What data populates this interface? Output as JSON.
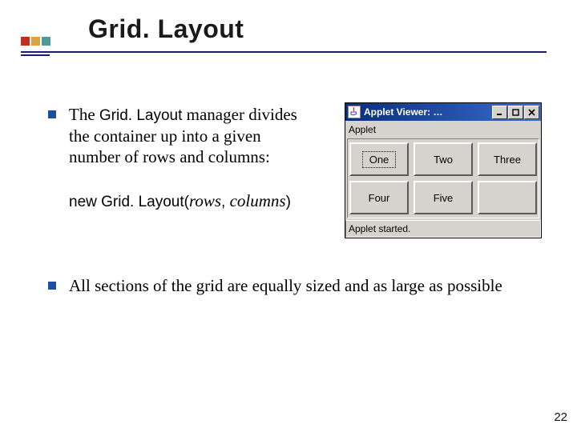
{
  "title": "Grid. Layout",
  "bullets": {
    "first": {
      "prefix": "The ",
      "class_name": "Grid. Layout",
      "rest": " manager divides the container up into a given number of rows and columns:"
    },
    "code": {
      "kw": "new ",
      "cls": "Grid. Layout",
      "open": "(",
      "arg1": "rows",
      "sep1": ", ",
      "arg2": "columns",
      "close": ")"
    },
    "second": "All sections of the grid are equally sized and as large as possible"
  },
  "applet": {
    "title": "Applet Viewer: …",
    "body_label": "Applet",
    "buttons": [
      "One",
      "Two",
      "Three",
      "Four",
      "Five",
      ""
    ],
    "status": "Applet started."
  },
  "page_number": "22"
}
